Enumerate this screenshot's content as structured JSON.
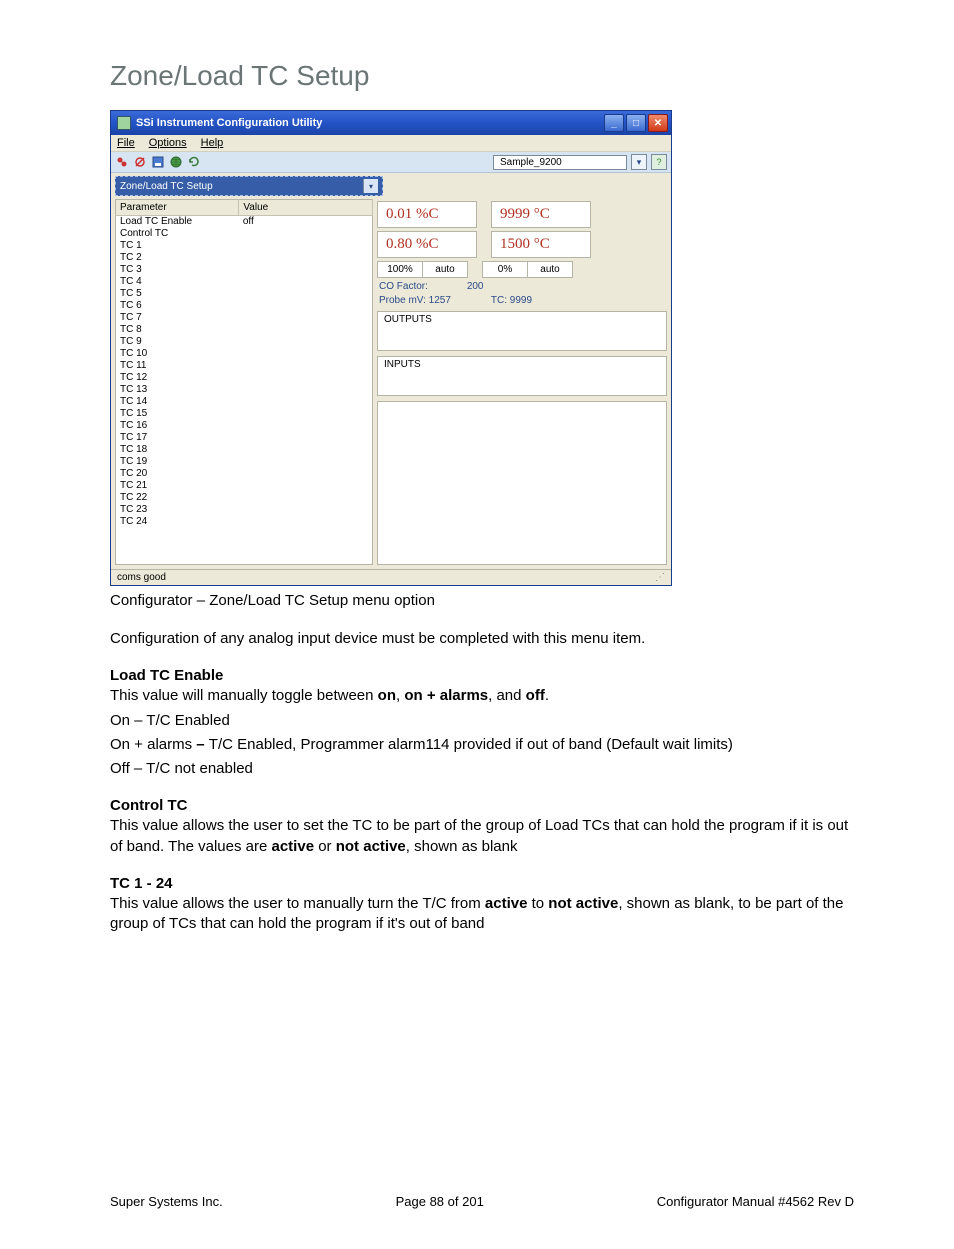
{
  "page_title": "Zone/Load TC Setup",
  "window": {
    "title": "SSi Instrument Configuration Utility",
    "menu": {
      "file": "File",
      "options": "Options",
      "help": "Help"
    },
    "sample_name": "Sample_9200",
    "dropdown_label": "Zone/Load TC Setup",
    "table_headers": {
      "param": "Parameter",
      "value": "Value"
    },
    "rows": [
      {
        "param": "Load TC Enable",
        "value": "off"
      },
      {
        "param": "Control TC",
        "value": ""
      },
      {
        "param": "TC 1",
        "value": ""
      },
      {
        "param": "TC 2",
        "value": ""
      },
      {
        "param": "TC 3",
        "value": ""
      },
      {
        "param": "TC 4",
        "value": ""
      },
      {
        "param": "TC 5",
        "value": ""
      },
      {
        "param": "TC 6",
        "value": ""
      },
      {
        "param": "TC 7",
        "value": ""
      },
      {
        "param": "TC 8",
        "value": ""
      },
      {
        "param": "TC 9",
        "value": ""
      },
      {
        "param": "TC 10",
        "value": ""
      },
      {
        "param": "TC 11",
        "value": ""
      },
      {
        "param": "TC 12",
        "value": ""
      },
      {
        "param": "TC 13",
        "value": ""
      },
      {
        "param": "TC 14",
        "value": ""
      },
      {
        "param": "TC 15",
        "value": ""
      },
      {
        "param": "TC 16",
        "value": ""
      },
      {
        "param": "TC 17",
        "value": ""
      },
      {
        "param": "TC 18",
        "value": ""
      },
      {
        "param": "TC 19",
        "value": ""
      },
      {
        "param": "TC 20",
        "value": ""
      },
      {
        "param": "TC 21",
        "value": ""
      },
      {
        "param": "TC 22",
        "value": ""
      },
      {
        "param": "TC 23",
        "value": ""
      },
      {
        "param": "TC 24",
        "value": ""
      }
    ],
    "readouts": {
      "pc_top": "0.01 %C",
      "temp_top": "9999 °C",
      "pc_bot": "0.80 %C",
      "temp_bot": "1500 °C"
    },
    "gauges": {
      "left_val": "100%",
      "left_mode": "auto",
      "right_val": "0%",
      "right_mode": "auto"
    },
    "info": {
      "co_factor_label": "CO Factor:",
      "co_factor_value": "200",
      "probe_label": "Probe mV: 1257",
      "tc_label": "TC: 9999"
    },
    "sections": {
      "outputs": "OUTPUTS",
      "inputs": "INPUTS"
    },
    "status": "coms good"
  },
  "caption": "Configurator – Zone/Load TC Setup menu option",
  "intro": "Configuration of any analog input device must be completed with this menu item.",
  "sections": {
    "load_tc": {
      "heading": "Load TC Enable",
      "l1a": "This value will manually toggle between ",
      "b1": "on",
      "c1": ", ",
      "b2": "on + alarms",
      "c2": ", and ",
      "b3": "off",
      "c3": ".",
      "l2": "On – T/C Enabled",
      "l3a": "On + alarms ",
      "l3b": "– ",
      "l3c": "T/C Enabled, Programmer alarm114 provided if out of band (Default wait limits)",
      "l4": "Off – T/C not enabled"
    },
    "control_tc": {
      "heading": "Control TC",
      "l1a": "This value allows the user to set the TC to be part of the group of Load TCs that can hold the program if it is out of band.  The values are ",
      "b1": "active",
      "c1": " or ",
      "b2": "not active",
      "c2": ", shown as blank"
    },
    "tc_range": {
      "heading": "TC 1 - 24",
      "l1a": "This value allows the user to manually turn the T/C from ",
      "b1": "active",
      "c1": " to ",
      "b2": "not active",
      "c2": ", shown as blank, to be part of the group of TCs that can hold the program if it's out of band"
    }
  },
  "footer": {
    "left": "Super Systems Inc.",
    "center": "Page 88 of 201",
    "right": "Configurator Manual #4562 Rev D"
  }
}
